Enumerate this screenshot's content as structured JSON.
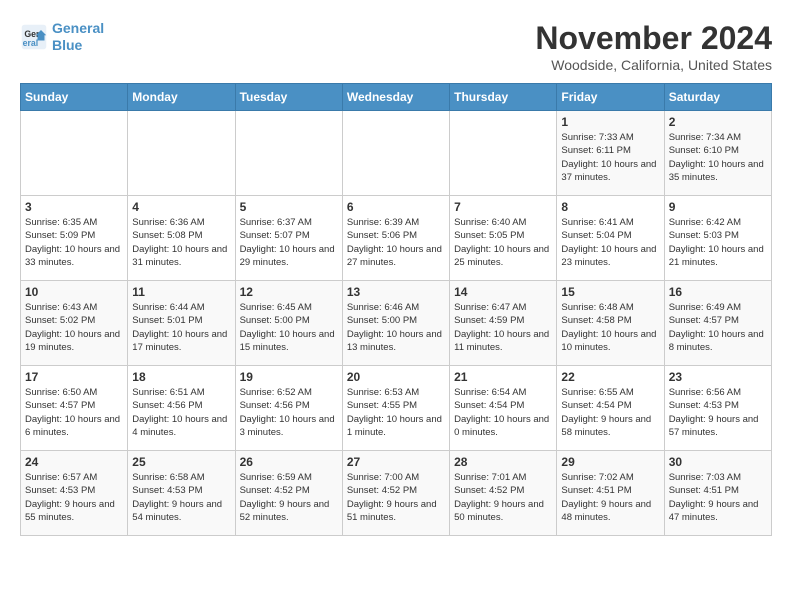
{
  "logo": {
    "line1": "General",
    "line2": "Blue"
  },
  "title": "November 2024",
  "subtitle": "Woodside, California, United States",
  "days_of_week": [
    "Sunday",
    "Monday",
    "Tuesday",
    "Wednesday",
    "Thursday",
    "Friday",
    "Saturday"
  ],
  "weeks": [
    [
      {
        "day": "",
        "info": ""
      },
      {
        "day": "",
        "info": ""
      },
      {
        "day": "",
        "info": ""
      },
      {
        "day": "",
        "info": ""
      },
      {
        "day": "",
        "info": ""
      },
      {
        "day": "1",
        "info": "Sunrise: 7:33 AM\nSunset: 6:11 PM\nDaylight: 10 hours and 37 minutes."
      },
      {
        "day": "2",
        "info": "Sunrise: 7:34 AM\nSunset: 6:10 PM\nDaylight: 10 hours and 35 minutes."
      }
    ],
    [
      {
        "day": "3",
        "info": "Sunrise: 6:35 AM\nSunset: 5:09 PM\nDaylight: 10 hours and 33 minutes."
      },
      {
        "day": "4",
        "info": "Sunrise: 6:36 AM\nSunset: 5:08 PM\nDaylight: 10 hours and 31 minutes."
      },
      {
        "day": "5",
        "info": "Sunrise: 6:37 AM\nSunset: 5:07 PM\nDaylight: 10 hours and 29 minutes."
      },
      {
        "day": "6",
        "info": "Sunrise: 6:39 AM\nSunset: 5:06 PM\nDaylight: 10 hours and 27 minutes."
      },
      {
        "day": "7",
        "info": "Sunrise: 6:40 AM\nSunset: 5:05 PM\nDaylight: 10 hours and 25 minutes."
      },
      {
        "day": "8",
        "info": "Sunrise: 6:41 AM\nSunset: 5:04 PM\nDaylight: 10 hours and 23 minutes."
      },
      {
        "day": "9",
        "info": "Sunrise: 6:42 AM\nSunset: 5:03 PM\nDaylight: 10 hours and 21 minutes."
      }
    ],
    [
      {
        "day": "10",
        "info": "Sunrise: 6:43 AM\nSunset: 5:02 PM\nDaylight: 10 hours and 19 minutes."
      },
      {
        "day": "11",
        "info": "Sunrise: 6:44 AM\nSunset: 5:01 PM\nDaylight: 10 hours and 17 minutes."
      },
      {
        "day": "12",
        "info": "Sunrise: 6:45 AM\nSunset: 5:00 PM\nDaylight: 10 hours and 15 minutes."
      },
      {
        "day": "13",
        "info": "Sunrise: 6:46 AM\nSunset: 5:00 PM\nDaylight: 10 hours and 13 minutes."
      },
      {
        "day": "14",
        "info": "Sunrise: 6:47 AM\nSunset: 4:59 PM\nDaylight: 10 hours and 11 minutes."
      },
      {
        "day": "15",
        "info": "Sunrise: 6:48 AM\nSunset: 4:58 PM\nDaylight: 10 hours and 10 minutes."
      },
      {
        "day": "16",
        "info": "Sunrise: 6:49 AM\nSunset: 4:57 PM\nDaylight: 10 hours and 8 minutes."
      }
    ],
    [
      {
        "day": "17",
        "info": "Sunrise: 6:50 AM\nSunset: 4:57 PM\nDaylight: 10 hours and 6 minutes."
      },
      {
        "day": "18",
        "info": "Sunrise: 6:51 AM\nSunset: 4:56 PM\nDaylight: 10 hours and 4 minutes."
      },
      {
        "day": "19",
        "info": "Sunrise: 6:52 AM\nSunset: 4:56 PM\nDaylight: 10 hours and 3 minutes."
      },
      {
        "day": "20",
        "info": "Sunrise: 6:53 AM\nSunset: 4:55 PM\nDaylight: 10 hours and 1 minute."
      },
      {
        "day": "21",
        "info": "Sunrise: 6:54 AM\nSunset: 4:54 PM\nDaylight: 10 hours and 0 minutes."
      },
      {
        "day": "22",
        "info": "Sunrise: 6:55 AM\nSunset: 4:54 PM\nDaylight: 9 hours and 58 minutes."
      },
      {
        "day": "23",
        "info": "Sunrise: 6:56 AM\nSunset: 4:53 PM\nDaylight: 9 hours and 57 minutes."
      }
    ],
    [
      {
        "day": "24",
        "info": "Sunrise: 6:57 AM\nSunset: 4:53 PM\nDaylight: 9 hours and 55 minutes."
      },
      {
        "day": "25",
        "info": "Sunrise: 6:58 AM\nSunset: 4:53 PM\nDaylight: 9 hours and 54 minutes."
      },
      {
        "day": "26",
        "info": "Sunrise: 6:59 AM\nSunset: 4:52 PM\nDaylight: 9 hours and 52 minutes."
      },
      {
        "day": "27",
        "info": "Sunrise: 7:00 AM\nSunset: 4:52 PM\nDaylight: 9 hours and 51 minutes."
      },
      {
        "day": "28",
        "info": "Sunrise: 7:01 AM\nSunset: 4:52 PM\nDaylight: 9 hours and 50 minutes."
      },
      {
        "day": "29",
        "info": "Sunrise: 7:02 AM\nSunset: 4:51 PM\nDaylight: 9 hours and 48 minutes."
      },
      {
        "day": "30",
        "info": "Sunrise: 7:03 AM\nSunset: 4:51 PM\nDaylight: 9 hours and 47 minutes."
      }
    ]
  ]
}
